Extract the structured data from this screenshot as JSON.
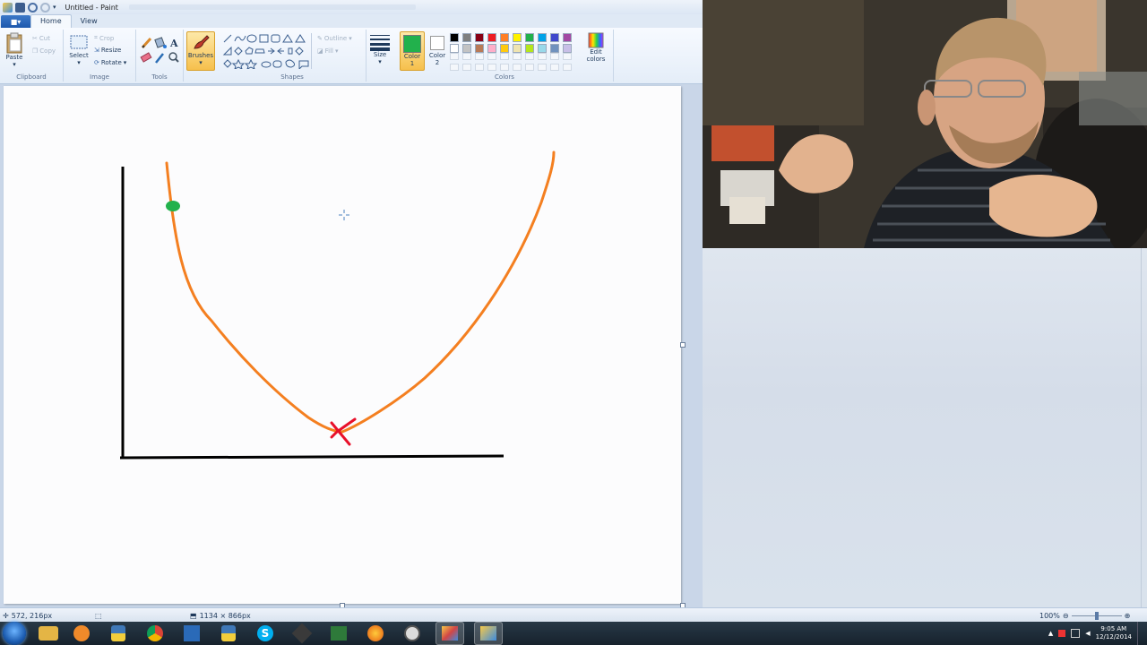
{
  "window": {
    "title": "Untitled - Paint"
  },
  "tabs": {
    "file_label": "■▾",
    "items": [
      "Home",
      "View"
    ]
  },
  "ribbon": {
    "clipboard": {
      "label": "Clipboard",
      "paste": "Paste",
      "cut": "Cut",
      "copy": "Copy"
    },
    "image": {
      "label": "Image",
      "select": "Select",
      "crop": "Crop",
      "resize": "Resize",
      "rotate": "Rotate"
    },
    "tools": {
      "label": "Tools"
    },
    "brushes": {
      "label": "Brushes"
    },
    "shapes": {
      "label": "Shapes",
      "outline": "Outline",
      "fill": "Fill"
    },
    "size": {
      "label": "Size"
    },
    "color1": {
      "label": "Color 1",
      "value": "#22b14c"
    },
    "color2": {
      "label": "Color 2",
      "value": "#ffffff"
    },
    "colors": {
      "label": "Colors",
      "edit": "Edit colors",
      "row1": [
        "#000000",
        "#7f7f7f",
        "#880015",
        "#ed1c24",
        "#ff7f27",
        "#fff200",
        "#22b14c",
        "#00a2e8",
        "#3f48cc",
        "#a349a4"
      ],
      "row2": [
        "#ffffff",
        "#c3c3c3",
        "#b97a57",
        "#ffaec9",
        "#ffc90e",
        "#efe4b0",
        "#b5e61d",
        "#99d9ea",
        "#7092be",
        "#c8bfe7"
      ]
    }
  },
  "drawing": {
    "curve_color": "#f47f20",
    "marker_color": "#22b14c",
    "x_mark_color": "#e8102a",
    "axis_color": "#000000"
  },
  "status": {
    "cursor_pos": "572, 216px",
    "image_size": "1134 × 866px",
    "zoom": "100%"
  },
  "taskbar": {
    "time": "9:05 AM",
    "date": "12/12/2014"
  }
}
